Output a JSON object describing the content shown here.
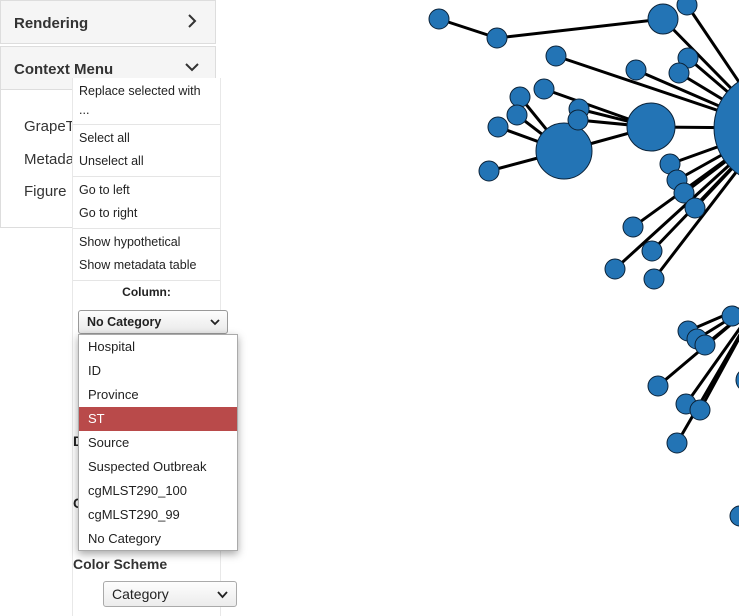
{
  "panels": {
    "rendering_title": "Rendering",
    "context_menu_title": "Context Menu"
  },
  "sidebar": {
    "links": [
      "GrapeT",
      "Metada",
      "Figure"
    ]
  },
  "context_menu": {
    "replace_selected_line1": "Replace selected with",
    "replace_selected_line2": "...",
    "select_all": "Select all",
    "unselect_all": "Unselect all",
    "go_to_left": "Go to left",
    "go_to_right": "Go to right",
    "show_hypothetical": "Show hypothetical",
    "show_metadata_table": "Show metadata table",
    "column_label": "Column:",
    "column_selected": "No Category"
  },
  "column_dropdown": {
    "options": [
      "Hospital",
      "ID",
      "Province",
      "ST",
      "Source",
      "Suspected Outbreak",
      "cgMLST290_100",
      "cgMLST290_99",
      "No Category"
    ],
    "highlighted": "ST"
  },
  "truncated_labels": [
    "D",
    "C"
  ],
  "color_scheme": {
    "label": "Color Scheme",
    "selected": "Category"
  },
  "colors": {
    "node_fill": "#2374b5",
    "edge": "#000000",
    "highlight": "#b94a4a"
  }
}
